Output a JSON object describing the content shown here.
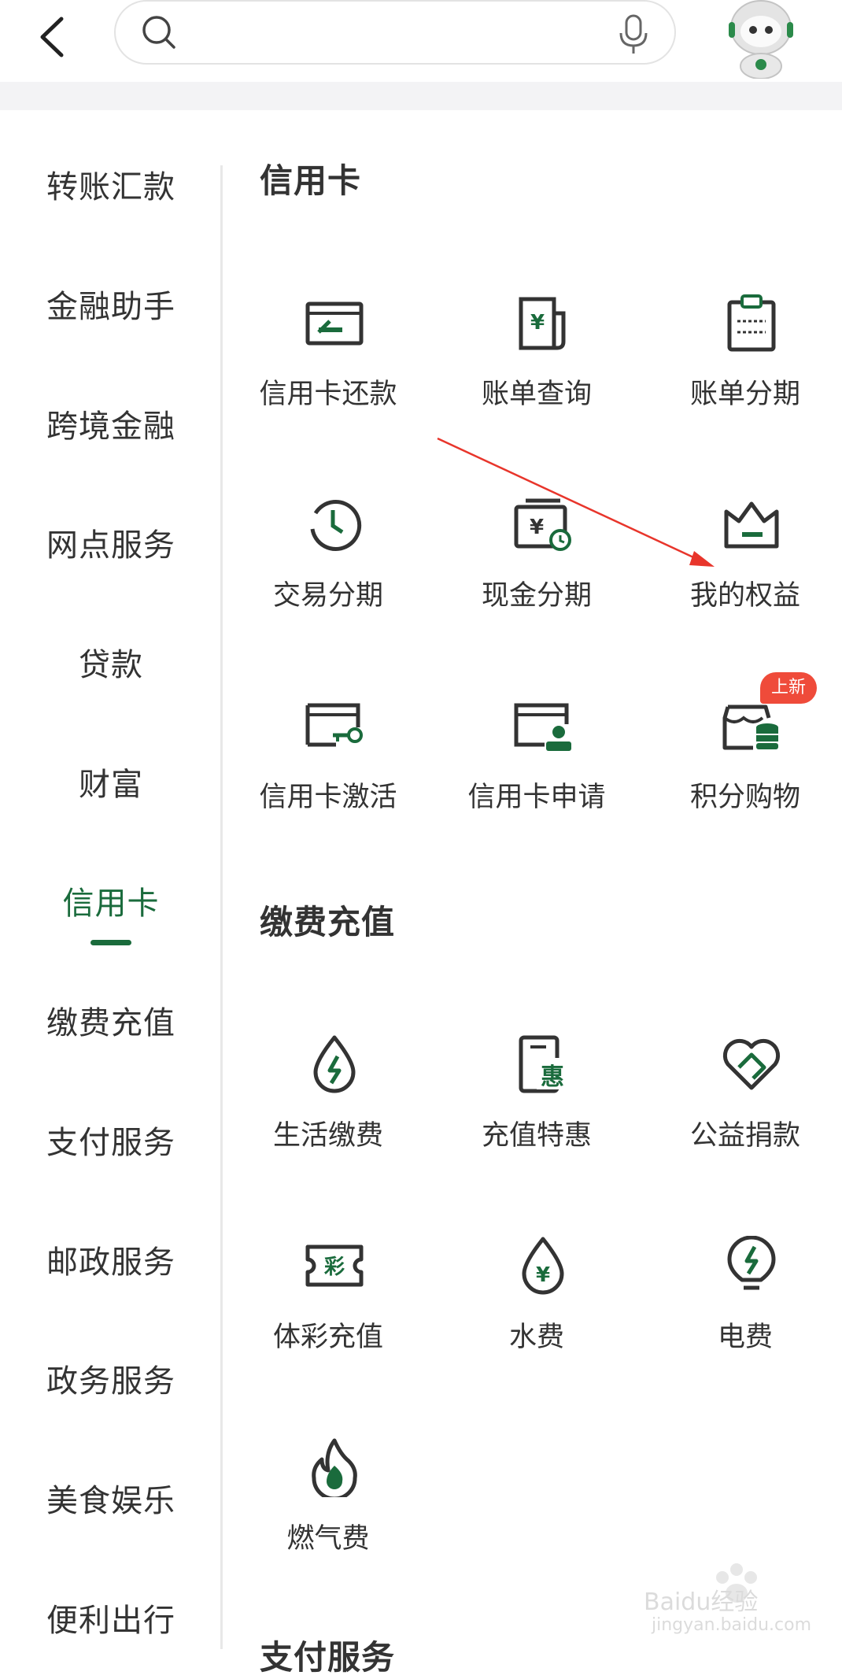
{
  "header": {
    "search_placeholder": "",
    "icons": [
      "back-arrow-icon",
      "search-icon",
      "microphone-icon",
      "robot-avatar"
    ]
  },
  "sidebar": {
    "items": [
      {
        "label": "转账汇款",
        "active": false
      },
      {
        "label": "金融助手",
        "active": false
      },
      {
        "label": "跨境金融",
        "active": false
      },
      {
        "label": "网点服务",
        "active": false
      },
      {
        "label": "贷款",
        "active": false
      },
      {
        "label": "财富",
        "active": false
      },
      {
        "label": "信用卡",
        "active": true
      },
      {
        "label": "缴费充值",
        "active": false
      },
      {
        "label": "支付服务",
        "active": false
      },
      {
        "label": "邮政服务",
        "active": false
      },
      {
        "label": "政务服务",
        "active": false
      },
      {
        "label": "美食娱乐",
        "active": false
      },
      {
        "label": "便利出行",
        "active": false
      }
    ]
  },
  "sections": [
    {
      "title": "信用卡",
      "items": [
        {
          "label": "信用卡还款",
          "icon": "card-repay-icon"
        },
        {
          "label": "账单查询",
          "icon": "bill-query-icon"
        },
        {
          "label": "账单分期",
          "icon": "bill-installment-icon"
        },
        {
          "label": "交易分期",
          "icon": "clock-installment-icon"
        },
        {
          "label": "现金分期",
          "icon": "cash-installment-icon"
        },
        {
          "label": "我的权益",
          "icon": "crown-icon"
        },
        {
          "label": "信用卡激活",
          "icon": "card-activate-icon"
        },
        {
          "label": "信用卡申请",
          "icon": "card-apply-icon"
        },
        {
          "label": "积分购物",
          "icon": "points-shop-icon",
          "badge": "上新"
        }
      ]
    },
    {
      "title": "缴费充值",
      "items": [
        {
          "label": "生活缴费",
          "icon": "life-payment-icon"
        },
        {
          "label": "充值特惠",
          "icon": "recharge-discount-icon"
        },
        {
          "label": "公益捐款",
          "icon": "charity-heart-icon"
        },
        {
          "label": "体彩充值",
          "icon": "lottery-ticket-icon"
        },
        {
          "label": "水费",
          "icon": "water-drop-icon"
        },
        {
          "label": "电费",
          "icon": "lightbulb-icon"
        },
        {
          "label": "燃气费",
          "icon": "gas-flame-icon"
        }
      ]
    },
    {
      "title": "支付服务"
    }
  ],
  "watermark": {
    "brand": "Baidu经验",
    "url": "jingyan.baidu.com"
  },
  "colors": {
    "accent": "#1a6b3c",
    "badge": "#ef4b3a",
    "annotation_arrow": "#e8352b"
  }
}
